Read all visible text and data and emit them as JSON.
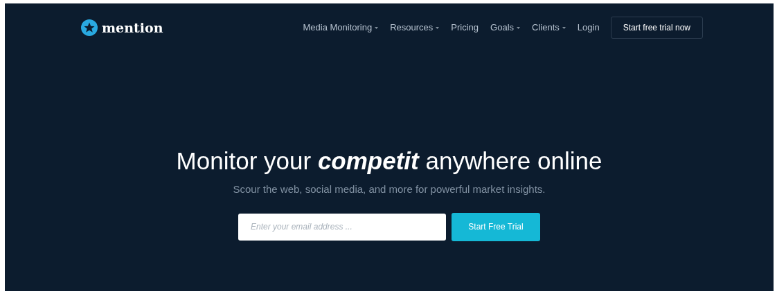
{
  "brand": {
    "name": "mention"
  },
  "nav": [
    {
      "label": "Media Monitoring",
      "dropdown": true
    },
    {
      "label": "Resources",
      "dropdown": true
    },
    {
      "label": "Pricing",
      "dropdown": false
    },
    {
      "label": "Goals",
      "dropdown": true
    },
    {
      "label": "Clients",
      "dropdown": true
    },
    {
      "label": "Login",
      "dropdown": false
    }
  ],
  "nav_cta": "Start free trial now",
  "hero": {
    "headline_before": "Monitor your",
    "headline_highlight": "competit",
    "headline_after": "anywhere online",
    "subtitle": "Scour the web, social media, and more for powerful market insights.",
    "email": {
      "placeholder": "Enter your email address ..."
    },
    "cta": "Start Free Trial"
  }
}
